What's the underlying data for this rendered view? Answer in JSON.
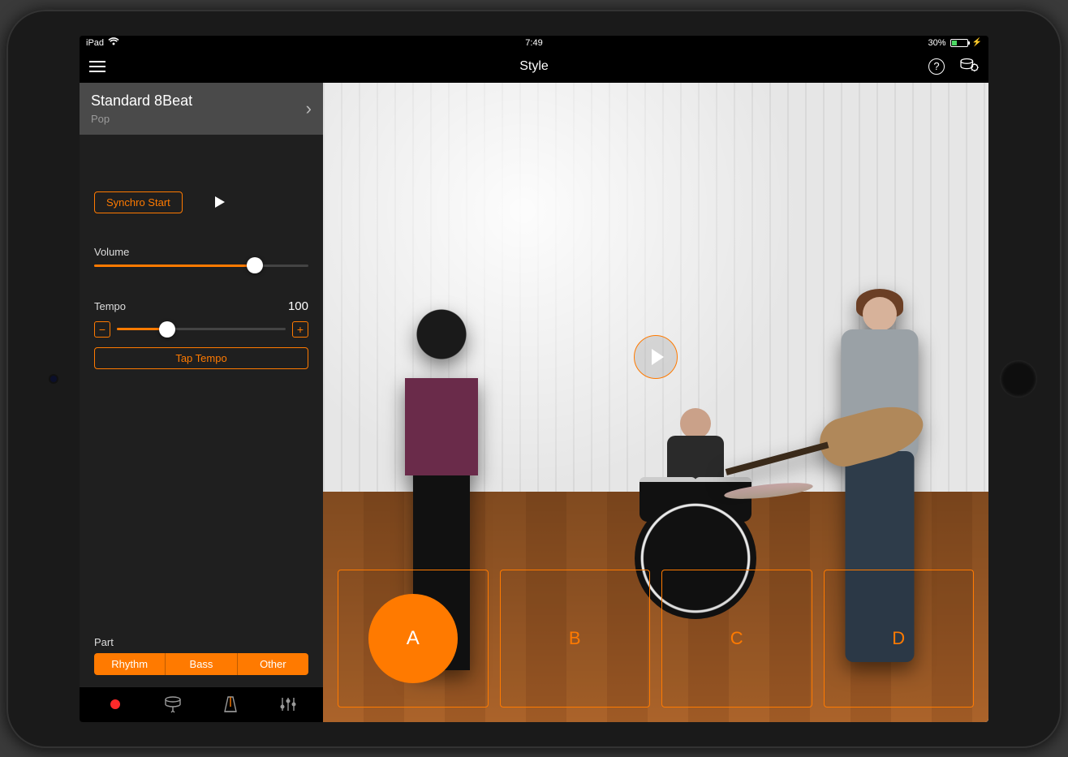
{
  "status": {
    "device": "iPad",
    "time": "7:49",
    "battery_percent": "30%"
  },
  "nav": {
    "title": "Style"
  },
  "style": {
    "name": "Standard 8Beat",
    "category": "Pop"
  },
  "controls": {
    "synchro_label": "Synchro Start",
    "volume_label": "Volume",
    "volume_percent": 75,
    "tempo_label": "Tempo",
    "tempo_value": "100",
    "tempo_percent": 30,
    "tap_tempo_label": "Tap Tempo"
  },
  "part": {
    "label": "Part",
    "segments": {
      "a": "Rhythm",
      "b": "Bass",
      "c": "Other"
    }
  },
  "pads": {
    "a": "A",
    "b": "B",
    "c": "C",
    "d": "D"
  },
  "colors": {
    "accent": "#ff7a00"
  }
}
